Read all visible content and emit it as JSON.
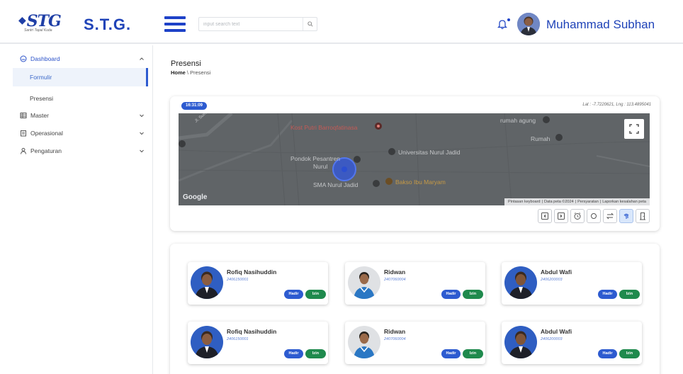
{
  "header": {
    "logo_text": "STG",
    "logo_tagline": "Santri Tapal Kuda",
    "brand": "S.T.G.",
    "search_placeholder": "input search text",
    "user_name": "Muhammad Subhan"
  },
  "sidebar": {
    "dashboard": "Dashboard",
    "formulir": "Formulir",
    "presensi": "Presensi",
    "master": "Master",
    "operasional": "Operasional",
    "pengaturan": "Pengaturan"
  },
  "page": {
    "title": "Presensi",
    "breadcrumb_home": "Home",
    "breadcrumb_sep": " \\ ",
    "breadcrumb_current": "Presensi"
  },
  "map": {
    "time": "16:31:09",
    "coords": "Lat : -7.7220621, Lng : 113.4895041",
    "places": {
      "kost": "Kost Putri Barroqfatinasa",
      "rumah_agung": "rumah agung",
      "rumah": "Rumah",
      "pondok1": "Pondok Pesantren",
      "pondok2": "Nurul",
      "universitas": "Universitas Nurul Jadid",
      "sma": "SMA Nurul Jadid",
      "bakso": "Bakso Ibu Maryam",
      "road": "Jl. Sumur Tegal"
    },
    "google": "Google",
    "attribution": {
      "keyboard": "Pintasan keyboard",
      "data": "Data peta ©2024",
      "terms": "Persyaratan",
      "report": "Laporkan kesalahan peta"
    }
  },
  "people": [
    {
      "name": "Rofiq Nasihuddin",
      "id": "2406150001",
      "avatar": "man"
    },
    {
      "name": "Ridwan",
      "id": "2407060004",
      "avatar": "boy"
    },
    {
      "name": "Abdul Wafi",
      "id": "2406200003",
      "avatar": "man"
    },
    {
      "name": "Rofiq Nasihuddin",
      "id": "2406150001",
      "avatar": "man"
    },
    {
      "name": "Ridwan",
      "id": "2407060004",
      "avatar": "boy"
    },
    {
      "name": "Abdul Wafi",
      "id": "2406200003",
      "avatar": "man"
    }
  ],
  "buttons": {
    "hadir": "Hadir",
    "izin": "Izin"
  },
  "colors": {
    "primary": "#1e42c8",
    "accent": "#2d5bd0",
    "success": "#1f8a4d"
  },
  "icons": {
    "toolbar": [
      "prev-icon",
      "next-icon",
      "alarm-icon",
      "circle-icon",
      "swap-icon",
      "fingerprint-icon",
      "door-icon"
    ]
  }
}
